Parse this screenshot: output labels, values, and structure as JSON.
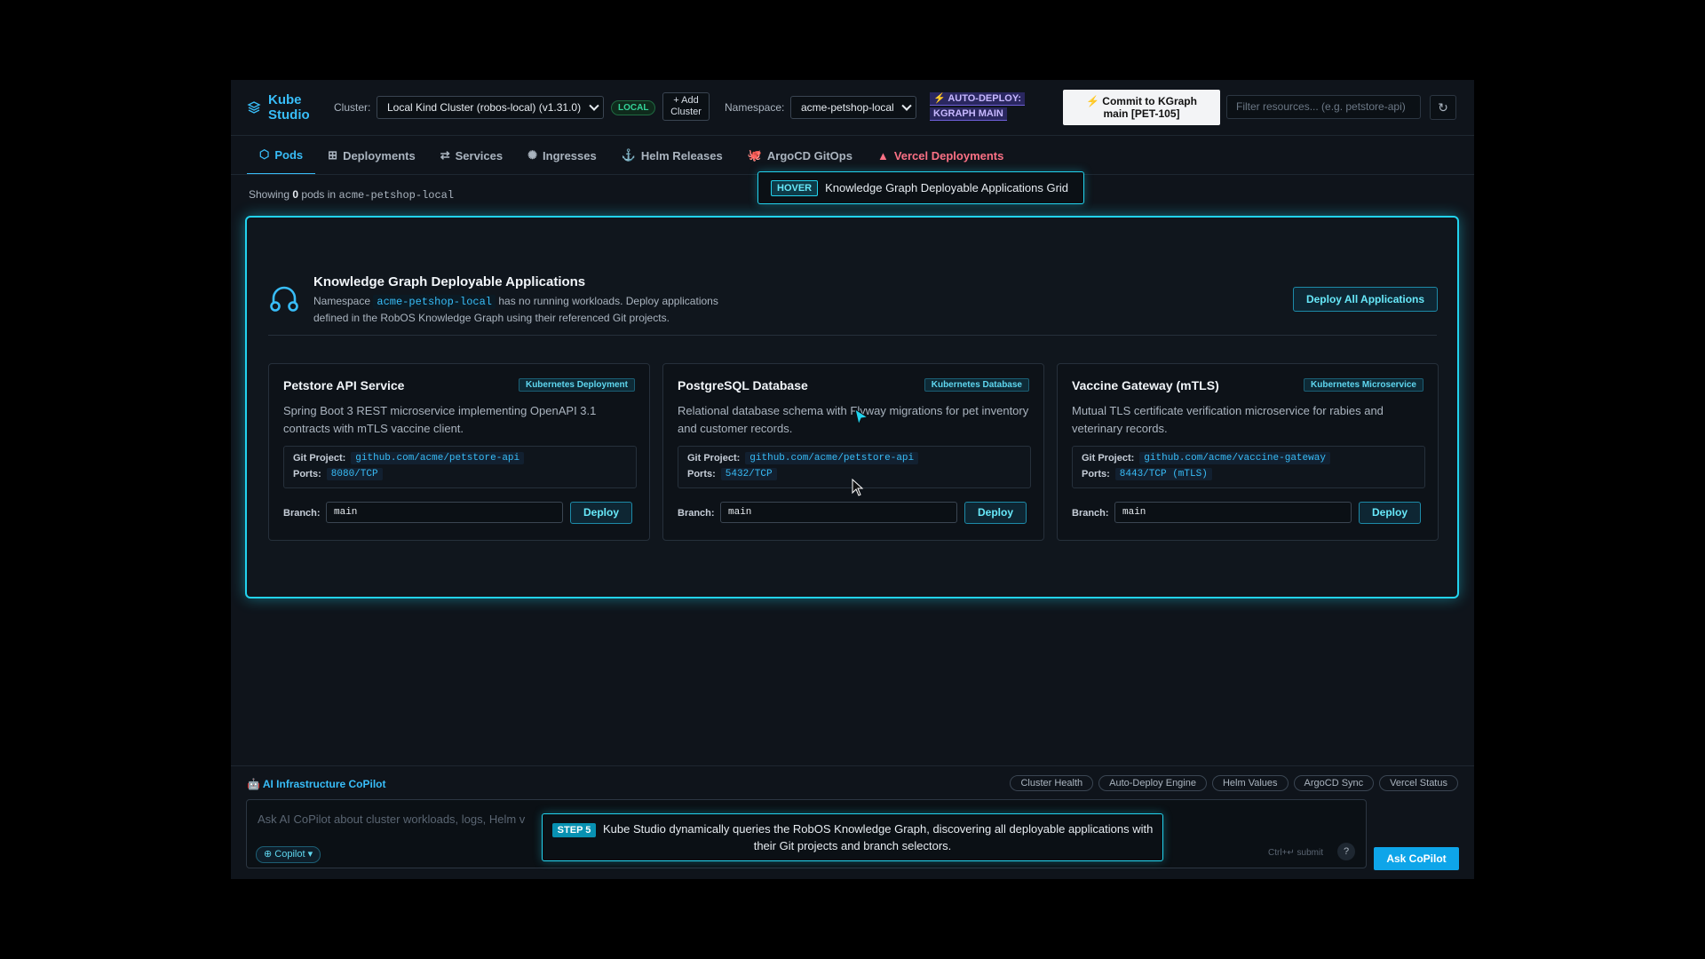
{
  "header": {
    "logo_line1": "Kube",
    "logo_line2": "Studio",
    "cluster_label": "Cluster:",
    "cluster_value": "Local Kind Cluster (robos-local) (v1.31.0)",
    "local_badge": "LOCAL",
    "add_cluster_line1": "+ Add",
    "add_cluster_line2": "Cluster",
    "namespace_label": "Namespace:",
    "namespace_value": "acme-petshop-local",
    "autodeploy_line1": "⚡ AUTO-DEPLOY:",
    "autodeploy_line2": "KGRAPH MAIN",
    "commit_line1": "⚡ Commit to KGraph",
    "commit_line2": "main [PET-105]",
    "filter_placeholder": "Filter resources... (e.g. petstore-api)",
    "refresh_icon": "↻"
  },
  "tabs": [
    {
      "icon": "⬡",
      "label": "Pods"
    },
    {
      "icon": "⊞",
      "label": "Deployments"
    },
    {
      "icon": "⇄",
      "label": "Services"
    },
    {
      "icon": "✺",
      "label": "Ingresses"
    },
    {
      "icon": "⚓",
      "label": "Helm Releases"
    },
    {
      "icon": "🐙",
      "label": "ArgoCD GitOps"
    },
    {
      "icon": "▲",
      "label": "Vercel Deployments"
    }
  ],
  "hover_tip": {
    "tag": "HOVER",
    "text": "Knowledge Graph Deployable Applications Grid"
  },
  "showing": {
    "prefix": "Showing",
    "count": "0",
    "middle": "pods in",
    "namespace": "acme-petshop-local"
  },
  "kg": {
    "title": "Knowledge Graph Deployable Applications",
    "desc_prefix": "Namespace",
    "desc_ns": "acme-petshop-local",
    "desc_suffix": "has no running workloads. Deploy applications defined in the RobOS Knowledge Graph using their referenced Git projects.",
    "deploy_all": "Deploy All Applications"
  },
  "cards": [
    {
      "title": "Petstore API Service",
      "badge": "Kubernetes Deployment",
      "desc": "Spring Boot 3 REST microservice implementing OpenAPI 3.1 contracts with mTLS vaccine client.",
      "git_label": "Git Project:",
      "git": "github.com/acme/petstore-api",
      "ports_label": "Ports:",
      "ports": "8080/TCP",
      "branch_label": "Branch:",
      "branch": "main",
      "deploy": "Deploy"
    },
    {
      "title": "PostgreSQL Database",
      "badge": "Kubernetes Database",
      "desc": "Relational database schema with Flyway migrations for pet inventory and customer records.",
      "git_label": "Git Project:",
      "git": "github.com/acme/petstore-api",
      "ports_label": "Ports:",
      "ports": "5432/TCP",
      "branch_label": "Branch:",
      "branch": "main",
      "deploy": "Deploy"
    },
    {
      "title": "Vaccine Gateway (mTLS)",
      "badge": "Kubernetes Microservice",
      "desc": "Mutual TLS certificate verification microservice for rabies and veterinary records.",
      "git_label": "Git Project:",
      "git": "github.com/acme/vaccine-gateway",
      "ports_label": "Ports:",
      "ports": "8443/TCP (mTLS)",
      "branch_label": "Branch:",
      "branch": "main",
      "deploy": "Deploy"
    }
  ],
  "copilot": {
    "title": "🤖 AI Infrastructure CoPilot",
    "chips": [
      "Cluster Health",
      "Auto-Deploy Engine",
      "Helm Values",
      "ArgoCD Sync",
      "Vercel Status"
    ],
    "placeholder": "Ask AI CoPilot about cluster workloads, logs, Helm v",
    "selector": "⊕ Copilot ▾",
    "submit_hint": "Ctrl+↵ submit",
    "help": "?",
    "ask": "Ask CoPilot"
  },
  "step_tip": {
    "tag": "STEP 5",
    "text": "Kube Studio dynamically queries the RobOS Knowledge Graph, discovering all deployable applications with their Git projects and branch selectors."
  }
}
